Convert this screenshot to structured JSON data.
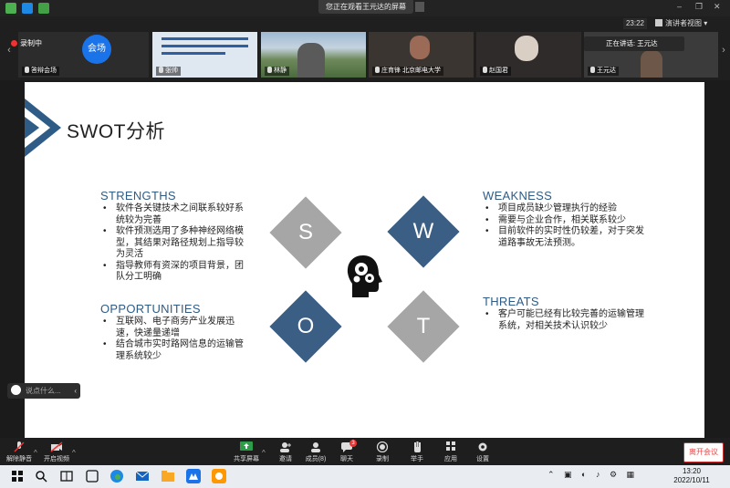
{
  "banner": "您正在观看王元达的屏幕",
  "meeting": {
    "timer": "23:22",
    "view_label": "演讲者视图",
    "recording_label": "录制中",
    "host_label": "会场",
    "speaking_label": "正在讲话: 王元达"
  },
  "participants": [
    {
      "name": "答辩会场"
    },
    {
      "name": "张帅"
    },
    {
      "name": "林静"
    },
    {
      "name": "庄育锋 北京邮电大学"
    },
    {
      "name": "赵国君"
    },
    {
      "name": "王元达"
    }
  ],
  "slide": {
    "title": "SWOT分析",
    "strengths": {
      "heading": "STRENGTHS",
      "items": [
        "软件各关键技术之间联系较好系统较为完善",
        "软件预测选用了多种神经网络模型，其结果对路径规划上指导较为灵活",
        "指导教师有资深的项目背景，团队分工明确"
      ]
    },
    "opportunities": {
      "heading": "OPPORTUNITIES",
      "items": [
        "互联网、电子商务产业发展迅速，快递量递增",
        "结合城市实时路网信息的运输管理系统较少"
      ]
    },
    "weakness": {
      "heading": "WEAKNESS",
      "items": [
        "项目成员缺少管理执行的经验",
        "需要与企业合作，相关联系较少",
        "目前软件的实时性仍较差，对于突发道路事故无法预测。"
      ]
    },
    "threats": {
      "heading": "THREATS",
      "items": [
        "客户可能已经有比较完善的运输管理系统，对相关技术认识较少"
      ]
    },
    "letters": {
      "s": "S",
      "w": "W",
      "o": "O",
      "t": "T"
    },
    "colors": {
      "gray": "#a6a6a6",
      "blue": "#3b5e84",
      "heading": "#2e5c87"
    }
  },
  "chat_placeholder": "说点什么...",
  "toolbar": {
    "mute": "解除静音",
    "video": "开启视频",
    "share": "共享屏幕",
    "invite": "邀请",
    "participants": "成员(8)",
    "chat": "聊天",
    "chat_badge": "3",
    "record": "录制",
    "raise": "举手",
    "apps": "应用",
    "settings": "设置",
    "leave": "离开会议"
  },
  "taskbar": {
    "time": "13:20",
    "date": "2022/10/11"
  }
}
